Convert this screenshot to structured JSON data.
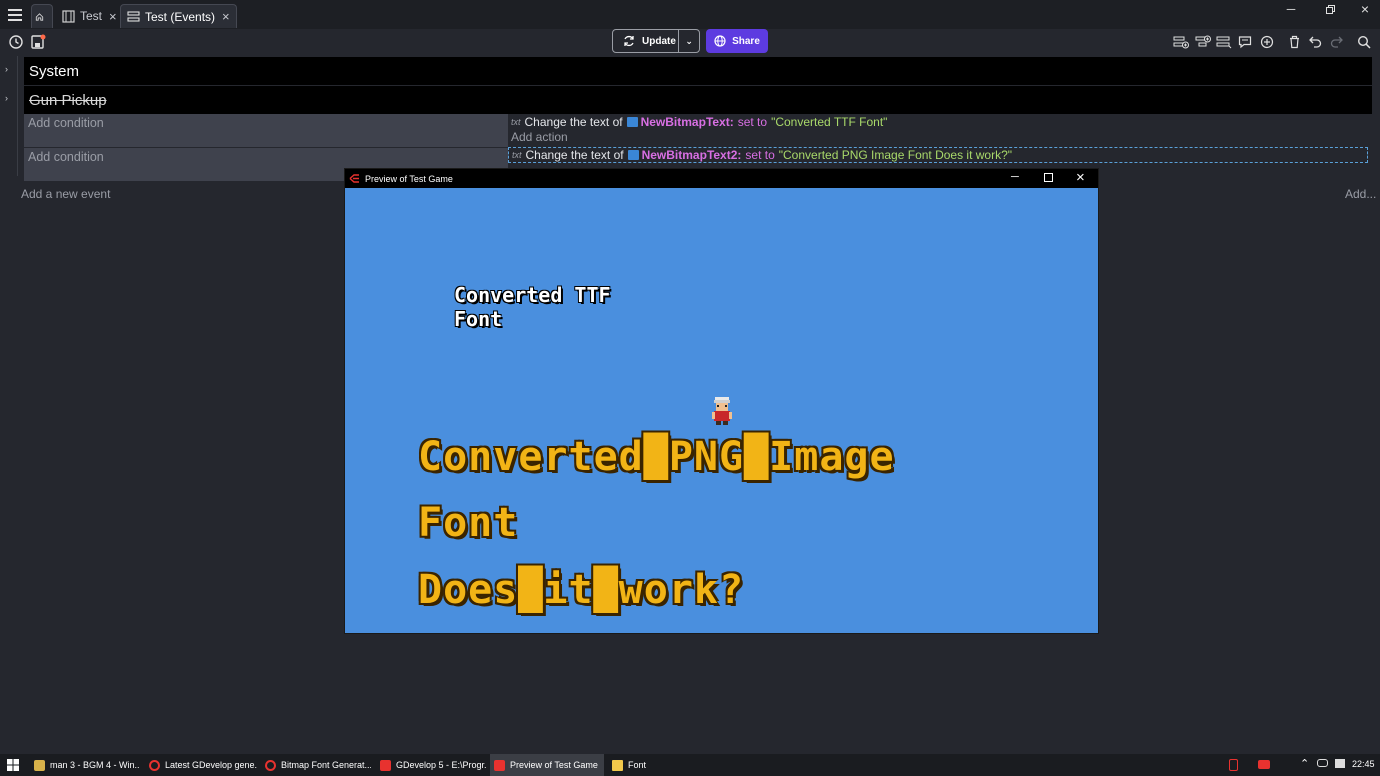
{
  "tabs": [
    {
      "label": "Test"
    },
    {
      "label": "Test (Events)"
    }
  ],
  "toolbar": {
    "update_label": "Update",
    "share_label": "Share"
  },
  "events": {
    "groups": [
      {
        "label": "System"
      },
      {
        "label": "Gun Pickup"
      }
    ],
    "rows": [
      {
        "condition_placeholder": "Add condition",
        "action": {
          "tag": "txt",
          "prefix": "Change the text of",
          "object": "NewBitmapText:",
          "setto": "set to",
          "value": "\"Converted TTF Font\""
        },
        "add_action": "Add action"
      },
      {
        "condition_placeholder": "Add condition",
        "action": {
          "tag": "txt",
          "prefix": "Change the text of",
          "object": "NewBitmapText2:",
          "setto": "set to",
          "value": "\"Converted PNG Image Font Does it work?\""
        }
      }
    ],
    "add_event": "Add a new event",
    "add_more": "Add..."
  },
  "preview": {
    "title": "Preview of Test Game",
    "ttf_text_line1": "Converted TTF",
    "ttf_text_line2": "Font",
    "png_text_line1": "Converted█PNG█Image",
    "png_text_line2": "Font",
    "png_text_line3": "Does█it█work?"
  },
  "taskbar": {
    "items": [
      {
        "label": "man 3 - BGM 4 - Win..."
      },
      {
        "label": "Latest GDevelop gene..."
      },
      {
        "label": "Bitmap Font Generat..."
      },
      {
        "label": "GDevelop 5 - E:\\Progr..."
      },
      {
        "label": "Preview of Test Game"
      },
      {
        "label": "Font"
      }
    ],
    "clock": "22:45"
  },
  "colors": {
    "accent": "#5d3be0",
    "game_bg": "#4a8fde",
    "object_name": "#d86fe3",
    "string_value": "#a9d96a"
  }
}
